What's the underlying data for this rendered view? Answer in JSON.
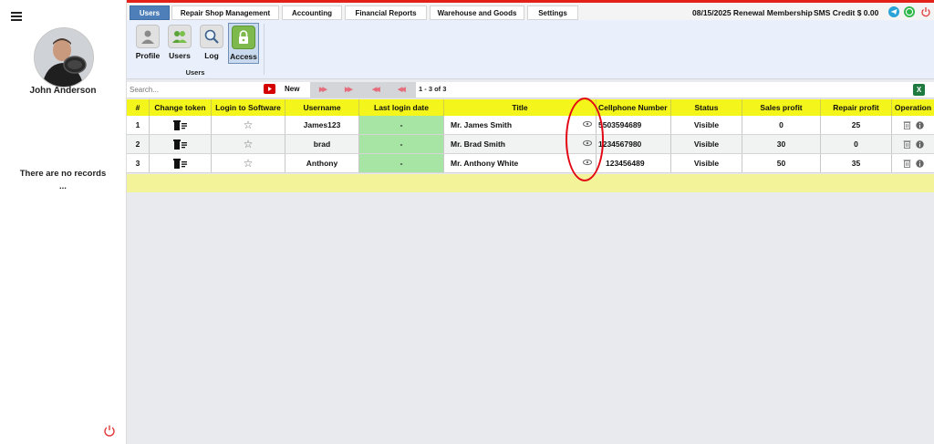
{
  "sidebar": {
    "user_name": "John Anderson",
    "empty_text": "There are no records",
    "empty_ellipsis": "..."
  },
  "topbar": {
    "tabs": [
      {
        "label": "Users",
        "active": true
      },
      {
        "label": "Repair Shop Management",
        "active": false
      },
      {
        "label": "Accounting",
        "active": false
      },
      {
        "label": "Financial Reports",
        "active": false
      },
      {
        "label": "Warehouse and Goods",
        "active": false
      },
      {
        "label": "Settings",
        "active": false
      }
    ],
    "renewal": "08/15/2025 Renewal Membership",
    "sms_credit": "SMS Credit $ 0.00",
    "icons": [
      "telegram-icon",
      "whatsapp-icon",
      "power-icon"
    ]
  },
  "ribbon": {
    "buttons": [
      {
        "label": "Profile",
        "icon": "profile-icon",
        "active": false
      },
      {
        "label": "Users",
        "icon": "users-icon",
        "active": false
      },
      {
        "label": "Log",
        "icon": "search-log-icon",
        "active": false
      },
      {
        "label": "Access",
        "icon": "lock-icon",
        "active": true
      }
    ],
    "group_label": "Users"
  },
  "toolbar": {
    "search_placeholder": "Search...",
    "new_label": "New",
    "page_info": "1 - 3 of 3"
  },
  "table": {
    "headers": [
      "#",
      "Change token",
      "Login to Software",
      "Username",
      "Last login date",
      "Title",
      "Cellphone Number",
      "Status",
      "Sales profit",
      "Repair profit",
      "Operation"
    ],
    "rows": [
      {
        "num": "1",
        "username": "James123",
        "last_login": "-",
        "title": "Mr. James Smith",
        "phone": "5503594689",
        "status": "Visible",
        "sales": "0",
        "repair": "25"
      },
      {
        "num": "2",
        "username": "brad",
        "last_login": "-",
        "title": "Mr. Brad Smith",
        "phone": "1234567980",
        "status": "Visible",
        "sales": "30",
        "repair": "0"
      },
      {
        "num": "3",
        "username": "Anthony",
        "last_login": "-",
        "title": "Mr. Anthony White",
        "phone": "123456489",
        "status": "Visible",
        "sales": "50",
        "repair": "35"
      }
    ]
  },
  "colors": {
    "accent_red": "#e32119",
    "header_yellow": "#f4f51a",
    "login_green": "#a6e5a3",
    "active_tab": "#4e7fb8"
  }
}
